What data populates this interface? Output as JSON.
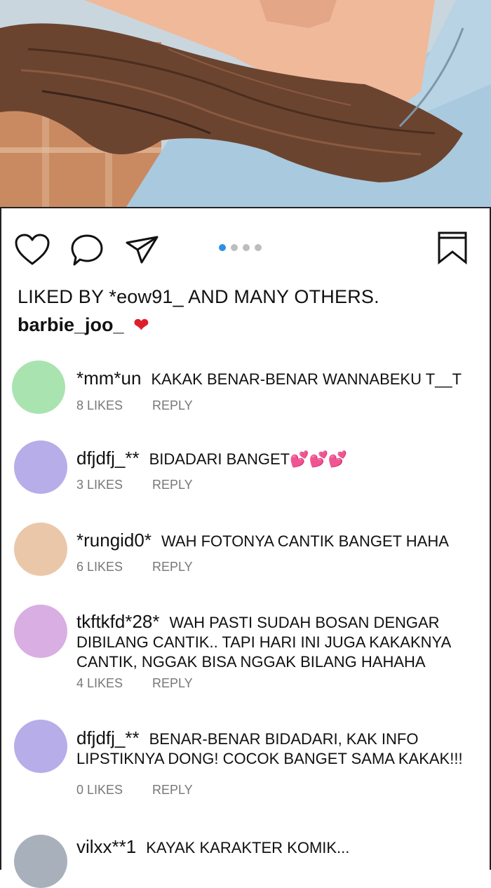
{
  "photo": {
    "alt": ""
  },
  "actions": {
    "like_icon": "heart-outline-icon",
    "comment_icon": "speech-bubble-icon",
    "share_icon": "paper-plane-icon",
    "save_icon": "bookmark-icon",
    "carousel": {
      "count": 4,
      "active": 1
    }
  },
  "post": {
    "liked_by_prefix": "LIKED BY ",
    "liked_by_user": "*eow91_",
    "liked_by_suffix": " AND MANY OTHERS.",
    "owner": "barbie_joo_",
    "owner_emoji": "❤"
  },
  "comments": [
    {
      "user": "*mm*un",
      "text": "KAKAK BENAR-BENAR WANNABEKU T__T",
      "likes": "8 LIKES",
      "reply": "REPLY",
      "avatar_color": "#a8e3b0"
    },
    {
      "user": "dfjdfj_**",
      "text": "BIDADARI BANGET💕💕💕",
      "likes": "3 LIKES",
      "reply": "REPLY",
      "avatar_color": "#b7ade8"
    },
    {
      "user": "*rungid0*",
      "text": "WAH FOTONYA CANTIK BANGET HAHA",
      "likes": "6 LIKES",
      "reply": "REPLY",
      "avatar_color": "#ebc7aa"
    },
    {
      "user": "tkftkfd*28*",
      "text": "WAH PASTI SUDAH BOSAN DENGAR DIBILANG CANTIK.. TAPI HARI INI JUGA KAKAKNYA CANTIK, NGGAK BISA NGGAK BILANG HAHAHA",
      "likes": "4 LIKES",
      "reply": "REPLY",
      "avatar_color": "#d9aee3"
    },
    {
      "user": "dfjdfj_**",
      "text": "BENAR-BENAR BIDADARI, KAK INFO LIPSTIKNYA DONG! COCOK BANGET SAMA KAKAK!!!",
      "likes": "0 LIKES",
      "reply": "REPLY",
      "avatar_color": "#b7ade8"
    },
    {
      "user": "vilxx**1",
      "text": "KAYAK KARAKTER KOMIK...",
      "likes": "",
      "reply": "",
      "avatar_color": "#a7b0bb"
    }
  ]
}
